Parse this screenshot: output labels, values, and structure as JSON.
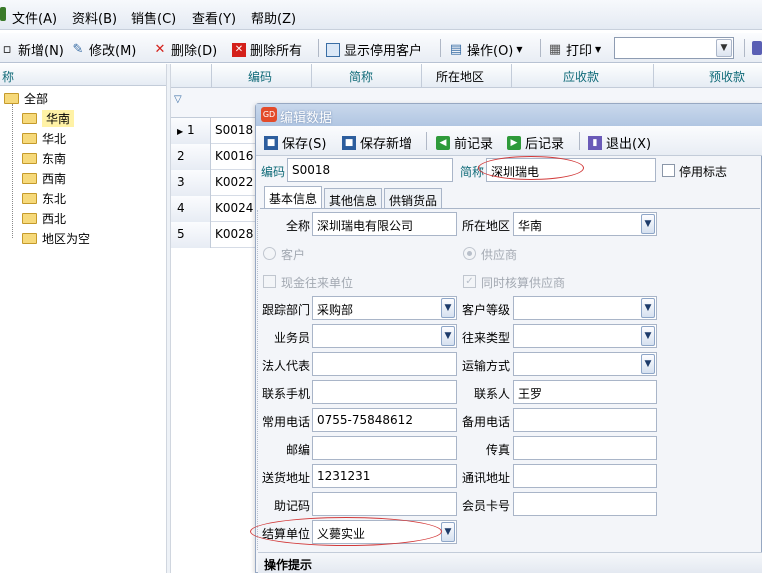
{
  "menu": [
    "文件(A)",
    "资料(B)",
    "销售(C)",
    "查看(Y)",
    "帮助(Z)"
  ],
  "toolbar": {
    "new": "新增(N)",
    "edit": "修改(M)",
    "delete": "删除(D)",
    "delete_all": "删除所有",
    "show_disabled": "显示停用客户",
    "operate": "操作(O)",
    "print": "打印"
  },
  "tree": {
    "header": "称",
    "root": "全部",
    "items": [
      "华南",
      "华北",
      "东南",
      "西南",
      "东北",
      "西北",
      "地区为空"
    ]
  },
  "grid": {
    "columns": [
      "编码",
      "简称",
      "所在地区",
      "应收款",
      "预收款"
    ],
    "rows": [
      {
        "num": "1",
        "code": "S0018"
      },
      {
        "num": "2",
        "code": "K0016"
      },
      {
        "num": "3",
        "code": "K0022"
      },
      {
        "num": "4",
        "code": "K0024"
      },
      {
        "num": "5",
        "code": "K0028"
      }
    ]
  },
  "dialog": {
    "title": "编辑数据",
    "icon_text": "GD",
    "toolbar": {
      "save": "保存(S)",
      "save_new": "保存新增",
      "prev": "前记录",
      "next": "后记录",
      "exit": "退出(X)"
    },
    "code_label": "编码",
    "code_value": "S0018",
    "short_label": "简称",
    "short_value": "深圳瑞电",
    "disabled_label": "停用标志",
    "tabs": [
      "基本信息",
      "其他信息",
      "供销货品"
    ],
    "fields": {
      "fullname_label": "全称",
      "fullname_value": "深圳瑞电有限公司",
      "region_label": "所在地区",
      "region_value": "华南",
      "customer_label": "客户",
      "supplier_label": "供应商",
      "cash_label": "现金往来单位",
      "sync_label": "同时核算供应商",
      "dept_label": "跟踪部门",
      "dept_value": "采购部",
      "level_label": "客户等级",
      "staff_label": "业务员",
      "type_label": "往来类型",
      "legal_label": "法人代表",
      "transport_label": "运输方式",
      "mobile_label": "联系手机",
      "contact_label": "联系人",
      "contact_value": "王罗",
      "phone_label": "常用电话",
      "phone_value": "0755-75848612",
      "backup_phone_label": "备用电话",
      "zip_label": "邮编",
      "fax_label": "传真",
      "address_label": "送货地址",
      "address_value": "1231231",
      "mail_address_label": "通讯地址",
      "memo_label": "助记码",
      "card_label": "会员卡号",
      "settle_label": "结算单位",
      "settle_value": "义薨实业"
    },
    "tip_title": "操作提示"
  }
}
